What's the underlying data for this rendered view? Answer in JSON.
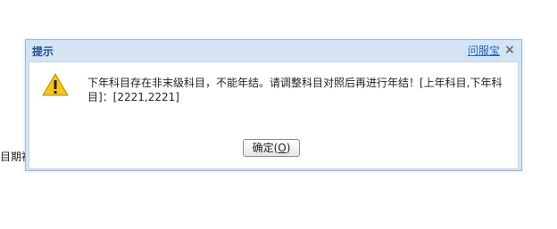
{
  "background": {
    "partial_label": "目期初"
  },
  "dialog": {
    "title": "提示",
    "help_link": "问服宝",
    "close_symbol": "×",
    "message": "下年科目存在非末级科目，不能年结。请调整科目对照后再进行年结！[上年科目,下年科目]：[2221,2221]",
    "ok_button": {
      "label": "确定(",
      "mnemonic": "O",
      "suffix": ")"
    },
    "icon": "warning-icon"
  },
  "colors": {
    "title_text": "#1f4f8f",
    "frame": "#d4e4f4",
    "link": "#1d64c8",
    "warning_fill": "#f5c518"
  }
}
